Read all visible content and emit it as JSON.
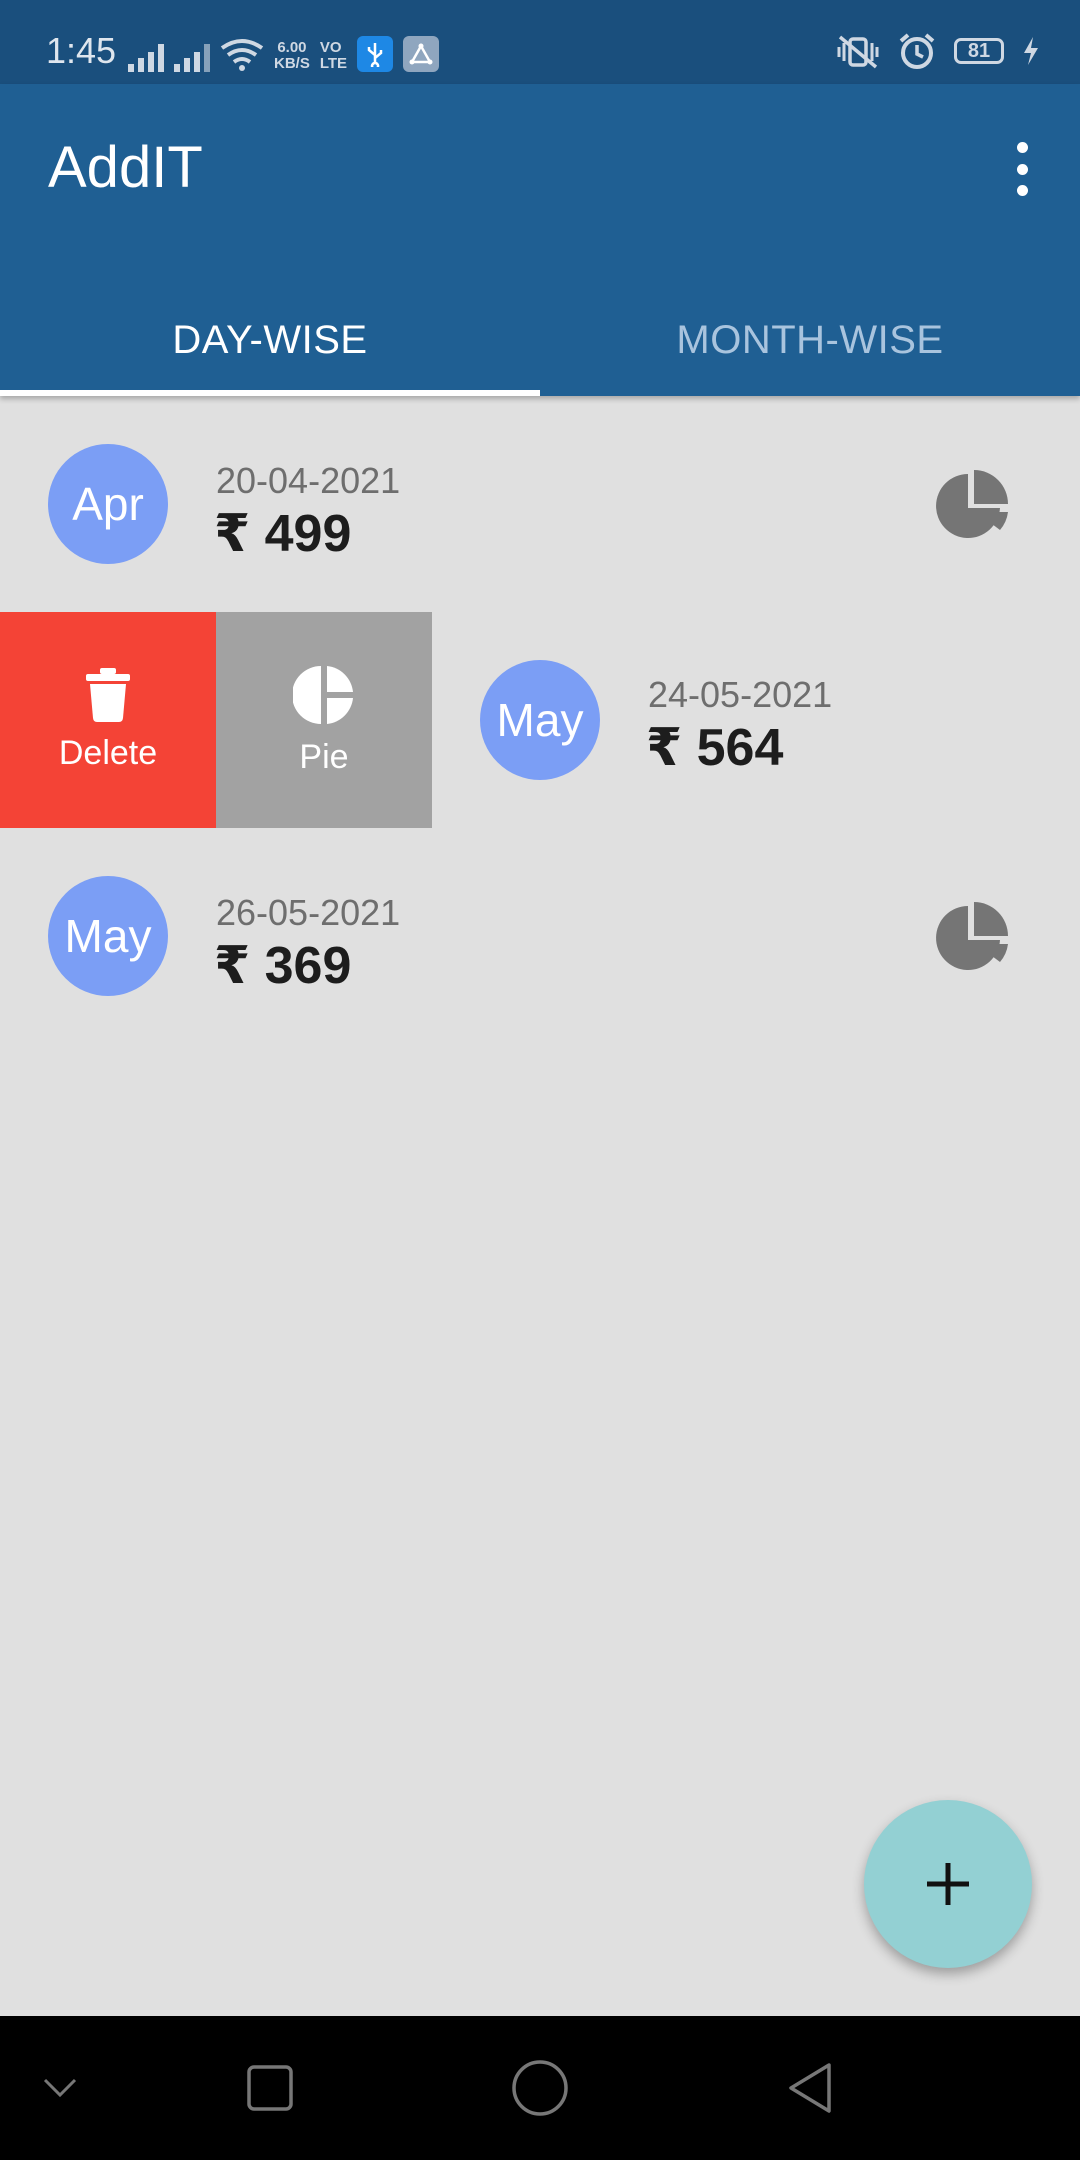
{
  "status_bar": {
    "time": "1:45",
    "speed_value": "6.00",
    "speed_unit": "KB/S",
    "volte_line1": "VO",
    "volte_line2": "LTE",
    "battery_level": "81"
  },
  "app_bar": {
    "title": "AddIT",
    "tabs": [
      {
        "label": "DAY-WISE",
        "selected": true
      },
      {
        "label": "MONTH-WISE",
        "selected": false
      }
    ]
  },
  "entries": [
    {
      "month": "Apr",
      "date": "20-04-2021",
      "amount": "₹ 499"
    },
    {
      "month": "May",
      "date": "24-05-2021",
      "amount": "₹ 564"
    },
    {
      "month": "May",
      "date": "26-05-2021",
      "amount": "₹ 369"
    }
  ],
  "swipe_actions": {
    "delete_label": "Delete",
    "pie_label": "Pie"
  },
  "fab": {
    "icon": "plus-icon"
  },
  "colors": {
    "app_bar": "#1f5f93",
    "status_bar": "#1a4f7d",
    "avatar": "#7b9ef5",
    "delete_action": "#f44336",
    "pie_action": "#a2a2a2",
    "fab": "#93d0d3",
    "background": "#e0e0e0"
  }
}
